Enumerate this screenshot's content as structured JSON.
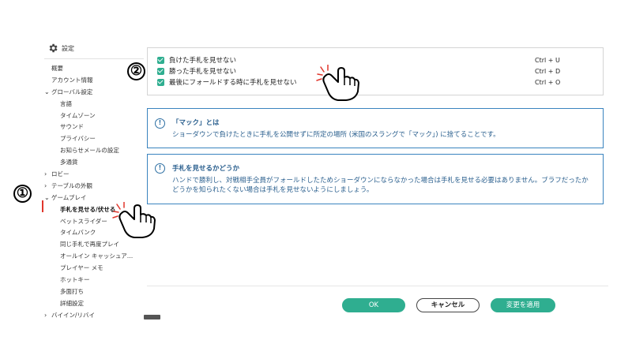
{
  "sidebar": {
    "header": {
      "title": "設定",
      "icon": "gear-icon"
    },
    "items": [
      {
        "label": "概要",
        "level": 0,
        "caret": ""
      },
      {
        "label": "アカウント情報",
        "level": 0,
        "caret": ""
      },
      {
        "label": "グローバル設定",
        "level": 0,
        "caret": "v"
      },
      {
        "label": "言語",
        "level": 1,
        "caret": ""
      },
      {
        "label": "タイムゾーン",
        "level": 1,
        "caret": ""
      },
      {
        "label": "サウンド",
        "level": 1,
        "caret": ""
      },
      {
        "label": "プライバシー",
        "level": 1,
        "caret": ""
      },
      {
        "label": "お知らせメールの設定",
        "level": 1,
        "caret": ""
      },
      {
        "label": "多通貨",
        "level": 1,
        "caret": ""
      },
      {
        "label": "ロビー",
        "level": 0,
        "caret": ">"
      },
      {
        "label": "テーブルの外観",
        "level": 0,
        "caret": ">"
      },
      {
        "label": "ゲームプレイ",
        "level": 0,
        "caret": "v"
      },
      {
        "label": "手札を見せる/伏せる",
        "level": 1,
        "caret": "",
        "active": true
      },
      {
        "label": "ベットスライダー",
        "level": 1,
        "caret": ""
      },
      {
        "label": "タイムバンク",
        "level": 1,
        "caret": ""
      },
      {
        "label": "同じ手札で再度プレイ",
        "level": 1,
        "caret": ""
      },
      {
        "label": "オールイン キャッシュア…",
        "level": 1,
        "caret": ""
      },
      {
        "label": "プレイヤー メモ",
        "level": 1,
        "caret": ""
      },
      {
        "label": "ホットキー",
        "level": 1,
        "caret": ""
      },
      {
        "label": "多面打ち",
        "level": 1,
        "caret": ""
      },
      {
        "label": "詳細設定",
        "level": 1,
        "caret": ""
      },
      {
        "label": "バイイン/リバイ",
        "level": 0,
        "caret": ">"
      }
    ]
  },
  "shortcuts": [
    {
      "label": "負けた手札を見せない",
      "key": "Ctrl + U",
      "checked": true
    },
    {
      "label": "勝った手札を見せない",
      "key": "Ctrl + D",
      "checked": true
    },
    {
      "label": "最後にフォールドする時に手札を見せない",
      "key": "Ctrl + O",
      "checked": true
    }
  ],
  "info1": {
    "icon": "!",
    "title": "「マック」とは",
    "text": "ショーダウンで負けたときに手札を公開せずに所定の場所 (米国のスラングで「マック」) に捨てることです。"
  },
  "info2": {
    "icon": "!",
    "title": "手札を見せるかどうか",
    "text": "ハンドで勝利し、対戦相手全員がフォールドしたためショーダウンにならなかった場合は手札を見せる必要はありません。ブラフだったかどうかを知られたくない場合は手札を見せないようにしましょう。"
  },
  "buttons": {
    "ok": "OK",
    "cancel": "キャンセル",
    "apply": "変更を適用"
  },
  "annotations": {
    "marker1": "①",
    "marker2": "②"
  },
  "colors": {
    "accent": "#2fae90",
    "info_border": "#3a84bf",
    "info_text": "#2a5f8e",
    "active_bar": "#e0362c"
  }
}
